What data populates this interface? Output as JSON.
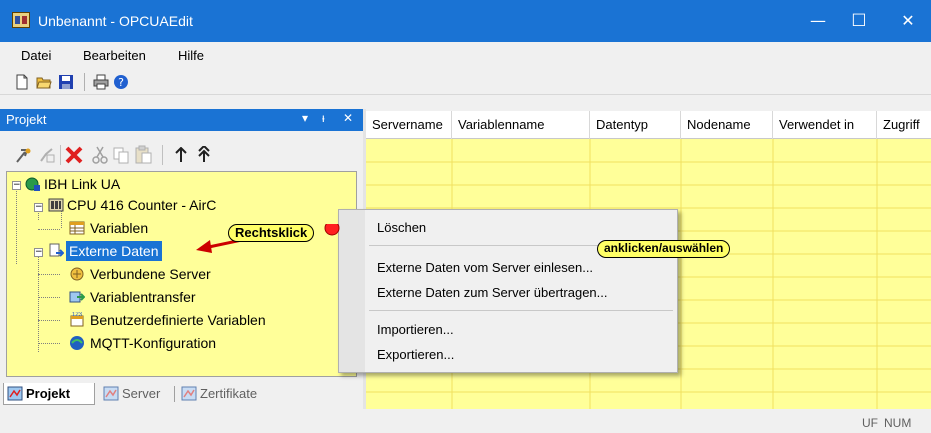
{
  "window": {
    "title": "Unbenannt - OPCUAEdit",
    "minimize": "—",
    "maximize": "☐",
    "close": "✕"
  },
  "menubar": {
    "items": [
      "Datei",
      "Bearbeiten",
      "Hilfe"
    ]
  },
  "toolbar": {
    "icons": [
      "new-document-icon",
      "open-folder-icon",
      "save-icon",
      "print-icon",
      "help-icon"
    ]
  },
  "panel": {
    "title": "Projekt",
    "controls": {
      "dropdown": "▾",
      "pin": "ᵼ",
      "close": "✕"
    },
    "tools": [
      "properties-icon",
      "disabled-icon",
      "delete-icon",
      "cut-icon",
      "copy-icon",
      "paste-icon",
      "move-up-icon",
      "move-top-icon"
    ]
  },
  "tree": {
    "root": "IBH Link UA",
    "cpu": "CPU 416 Counter - AirC",
    "variables": "Variablen",
    "external": "Externe Daten",
    "children": [
      "Verbundene Server",
      "Variablentransfer",
      "Benutzerdefinierte Variablen",
      "MQTT-Konfiguration"
    ]
  },
  "tabs": [
    "Projekt",
    "Server",
    "Zertifikate"
  ],
  "grid": {
    "columns": [
      "Servername",
      "Variablenname",
      "Datentyp",
      "Nodename",
      "Verwendet in",
      "Zugriff"
    ]
  },
  "context_menu": {
    "items": [
      "Löschen",
      "Externe Daten vom Server einlesen...",
      "Externe Daten zum Server übertragen...",
      "Importieren...",
      "Exportieren..."
    ]
  },
  "callouts": {
    "right_click": "Rechtsklick",
    "click_select": "anklicken/auswählen"
  },
  "status": {
    "uf": "UF",
    "num": "NUM"
  },
  "colors": {
    "titlebar": "#1a73d4",
    "highlight_background": "#ffff99",
    "selection": "#1a73d4",
    "callout": "#ffff66",
    "marker": "#ff0000"
  }
}
